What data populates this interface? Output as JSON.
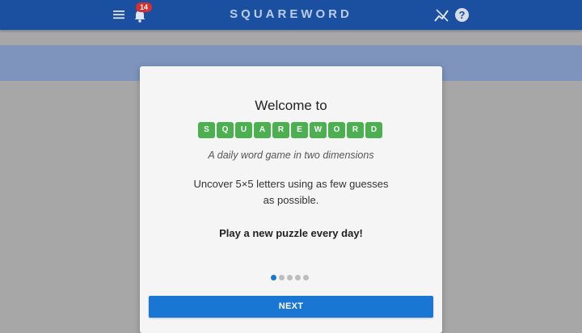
{
  "header": {
    "app_title": "SQUAREWORD",
    "notification_count": "14",
    "help_glyph": "?",
    "icons": [
      "menu-icon",
      "bell-icon",
      "stats-icon",
      "help-icon"
    ],
    "colors": {
      "bar": "#1b4fa0",
      "title": "#b9cdee",
      "badge": "#d32f2f"
    }
  },
  "modal": {
    "welcome": "Welcome to",
    "logo_letters": [
      "S",
      "Q",
      "U",
      "A",
      "R",
      "E",
      "W",
      "O",
      "R",
      "D"
    ],
    "tagline": "A daily word game in two dimensions",
    "description": "Uncover 5×5 letters using as few guesses as possible.",
    "call_to_action": "Play a new puzzle every day!",
    "pagination": {
      "total_pages": 5,
      "current_page": 1
    },
    "next_label": "NEXT",
    "colors": {
      "tile": "#4caf50",
      "accent": "#1976d2"
    }
  }
}
